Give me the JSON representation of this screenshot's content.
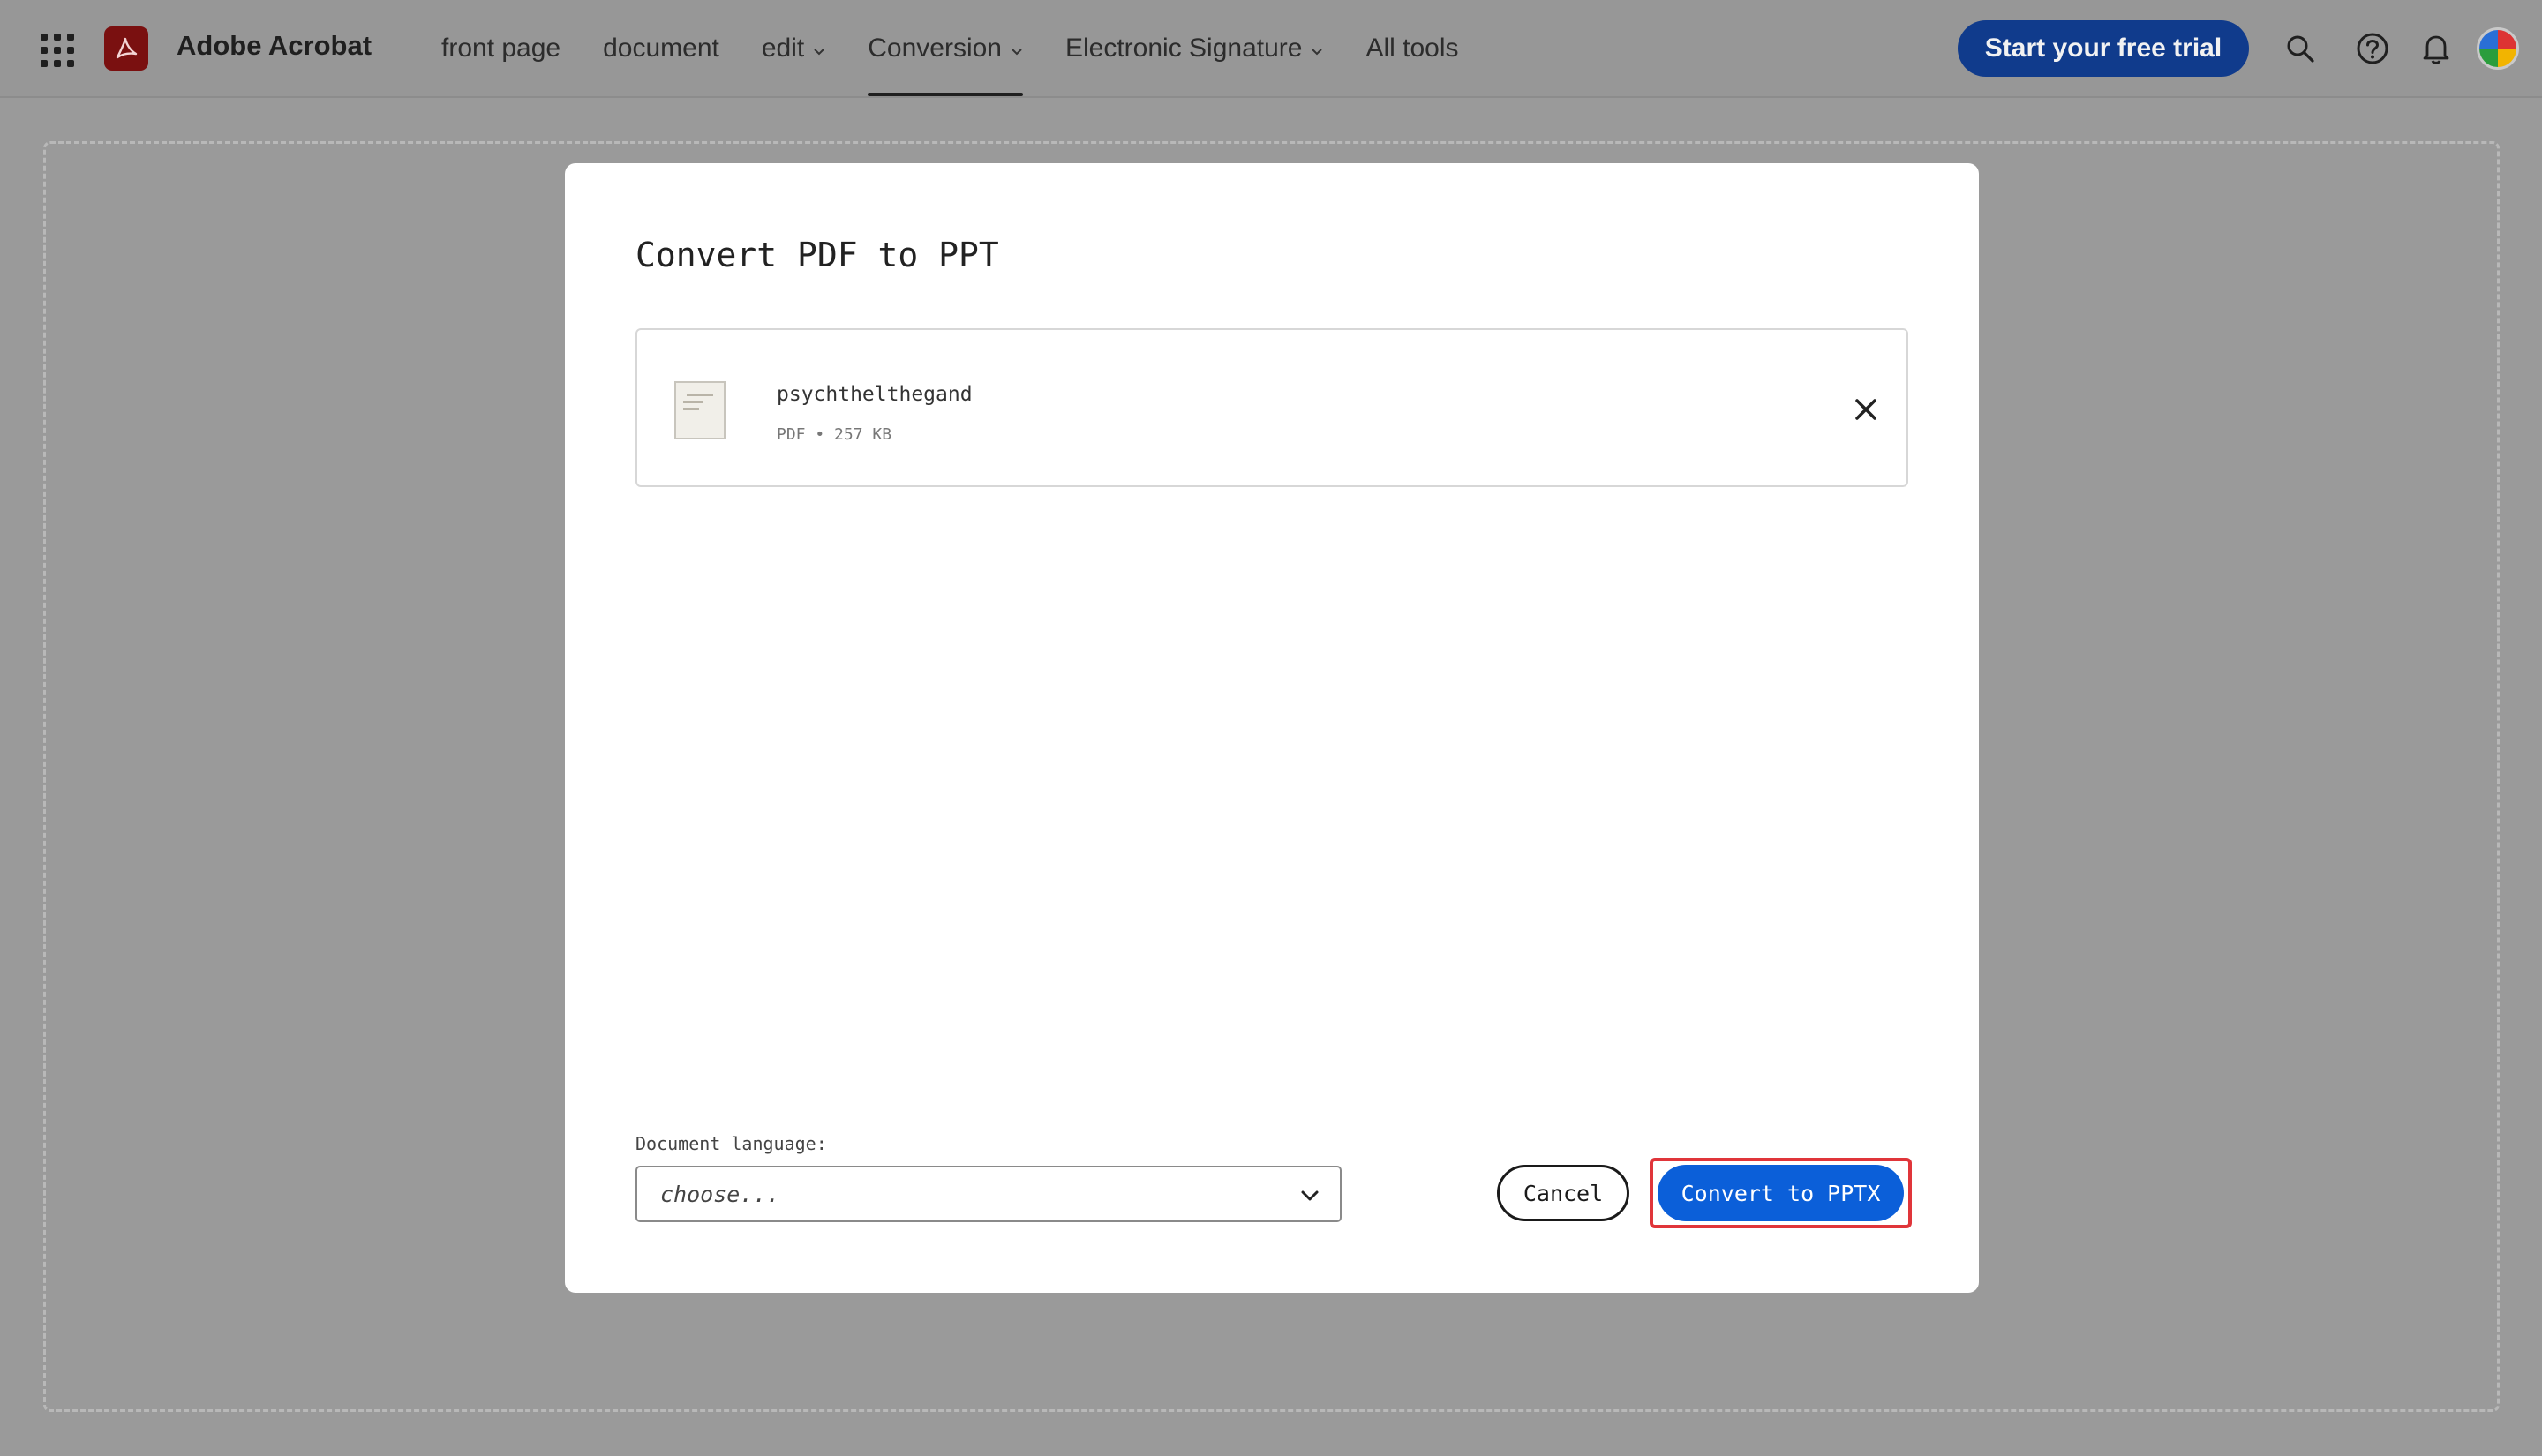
{
  "header": {
    "brand": "Adobe Acrobat",
    "nav": [
      {
        "label": "front page",
        "dropdown": false,
        "active": false
      },
      {
        "label": "document",
        "dropdown": false,
        "active": false
      },
      {
        "label": "edit",
        "dropdown": true,
        "active": false
      },
      {
        "label": "Conversion",
        "dropdown": true,
        "active": true
      },
      {
        "label": "Electronic Signature",
        "dropdown": true,
        "active": false
      },
      {
        "label": "All tools",
        "dropdown": false,
        "active": false
      }
    ],
    "trial_label": "Start your free trial",
    "icons": [
      "apps-grid-icon",
      "acrobat-logo-icon",
      "search-icon",
      "help-icon",
      "bell-icon",
      "avatar"
    ]
  },
  "modal": {
    "title": "Convert PDF to PPT",
    "file": {
      "name": "psychthelthegand",
      "meta": "PDF • 257 KB"
    },
    "language_label": "Document language:",
    "language_value": "choose...",
    "cancel_label": "Cancel",
    "convert_label": "Convert to PPTX"
  },
  "colors": {
    "overlay": "#9a9a9a",
    "trial_button": "#103b8c",
    "primary_button": "#0b5fd9",
    "highlight": "#e0353a",
    "logo": "#7a1010"
  }
}
